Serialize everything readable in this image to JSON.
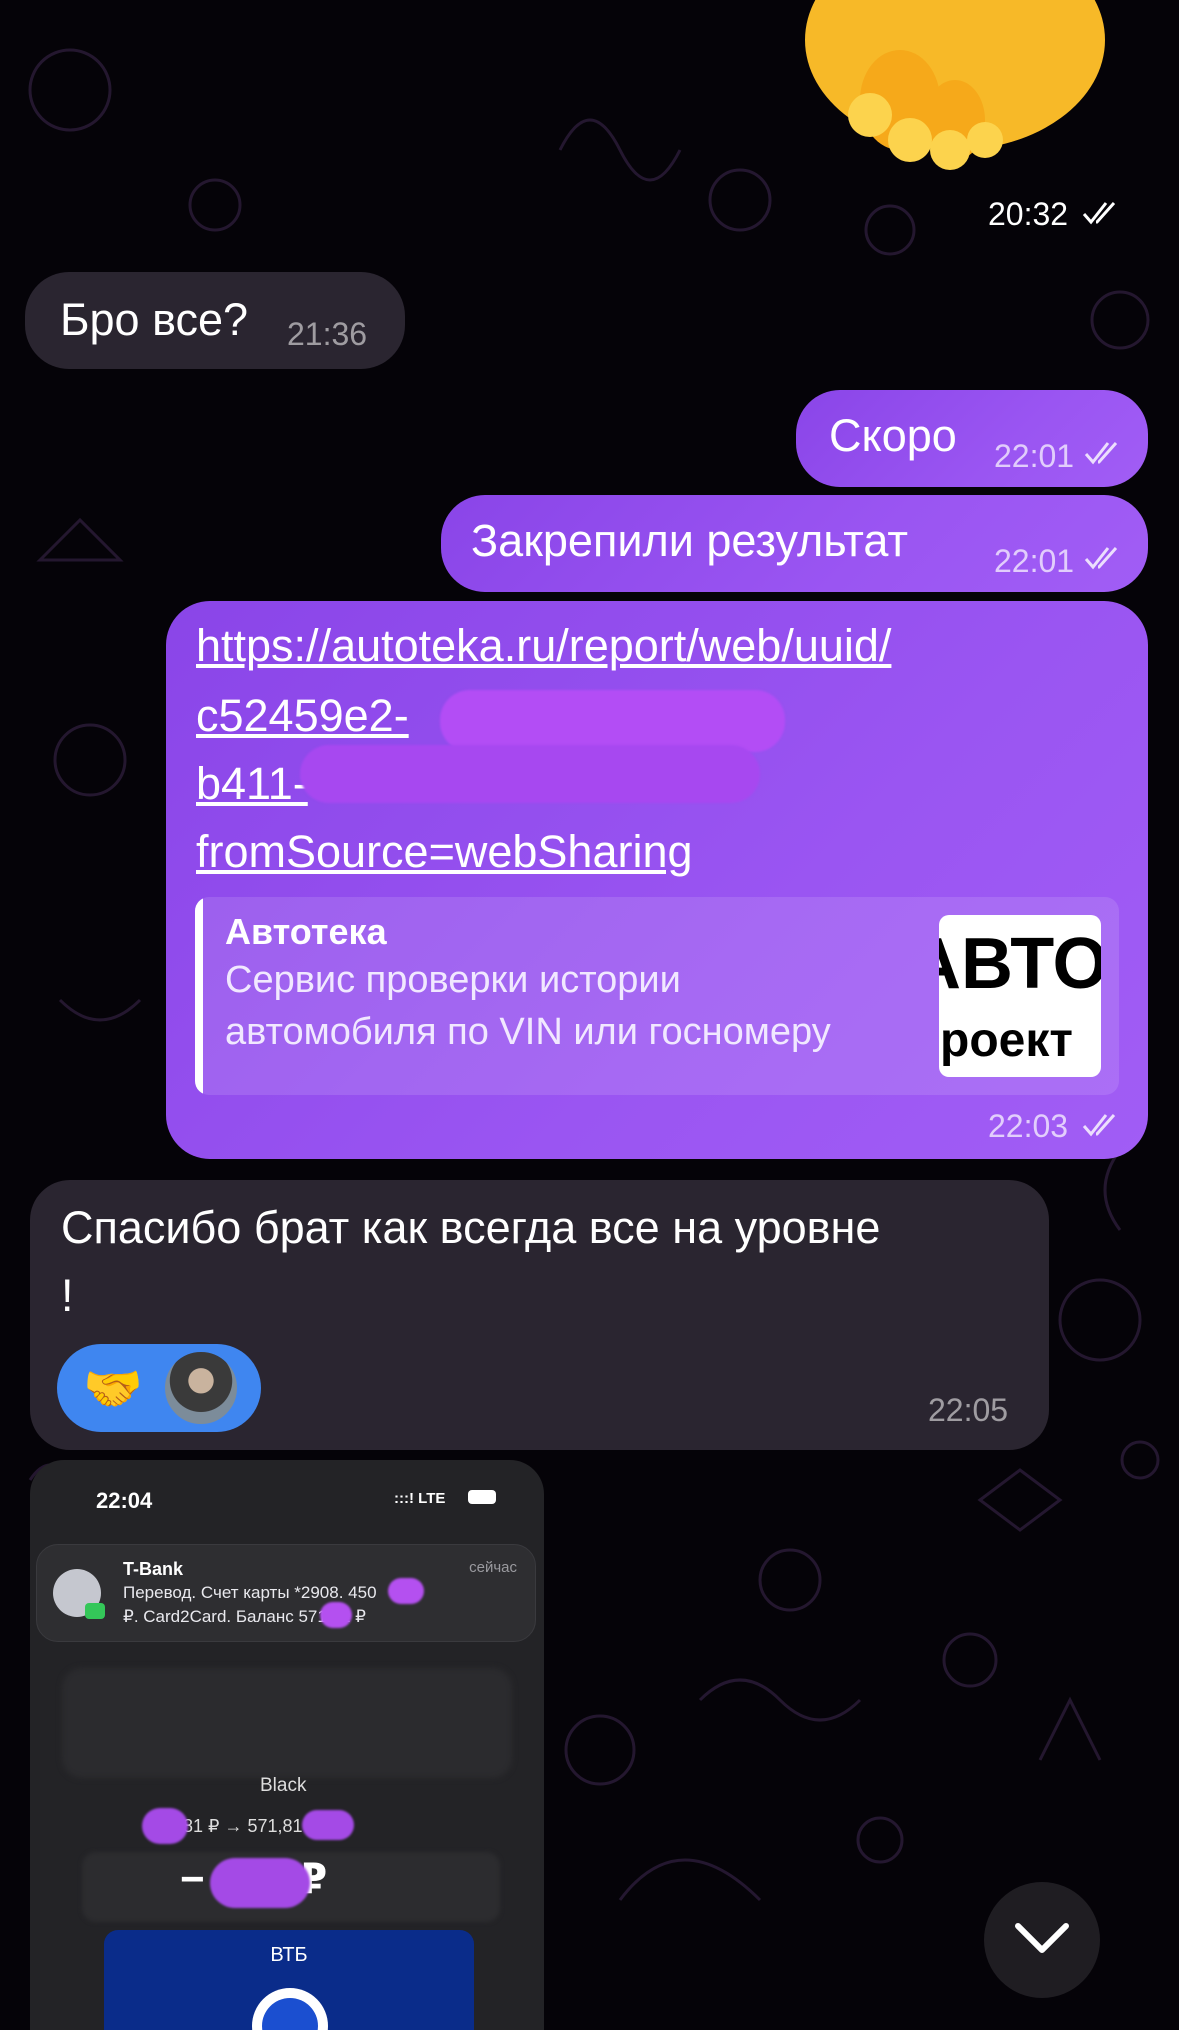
{
  "messages": {
    "top_time": "20:32",
    "m1_text": "Бро все?",
    "m1_time": "21:36",
    "m2_text": "Скоро",
    "m2_time": "22:01",
    "m3_text": "Закрепили результат",
    "m3_time": "22:01",
    "m4_link_1": "https://autoteka.ru/report/web/uuid/",
    "m4_link_2": "c52459e2-",
    "m4_link_3": "b411-",
    "m4_link_4": "fromSource=webSharing",
    "m4_preview_title": "Автотека",
    "m4_preview_desc_1": "Сервис проверки истории",
    "m4_preview_desc_2": "автомобиля по VIN или госномеру",
    "m4_preview_logo_1": "АВТО",
    "m4_preview_logo_2": "проект",
    "m4_time": "22:03",
    "m5_text_1": "Спасибо брат как всегда все на уровне",
    "m5_text_2": "!",
    "m5_reaction": "🤝",
    "m5_time": "22:05"
  },
  "photo": {
    "time": "22:04",
    "status": ":::! LTE",
    "notif_app": "T-Bank",
    "notif_when": "сейчас",
    "notif_line_1": "Перевод. Счет карты *2908.       450",
    "notif_line_2": "₽. Card2Card. Баланс      571,81 ₽",
    "account": "Black",
    "transfer": "      021,81 ₽   →        571,81 ₽",
    "amount": "−          450 ₽",
    "card_bank": "ВТБ"
  },
  "colors": {
    "outgoing": "#9a55f2",
    "incoming": "#2a2530",
    "reaction": "#3f86f0"
  }
}
